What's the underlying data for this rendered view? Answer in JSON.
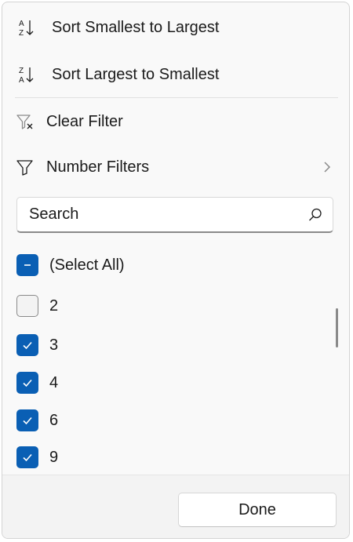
{
  "menu": {
    "sort_asc_label": "Sort Smallest to Largest",
    "sort_desc_label": "Sort Largest to Smallest",
    "clear_filter_label": "Clear Filter",
    "number_filters_label": "Number Filters"
  },
  "search": {
    "placeholder": "Search",
    "value": ""
  },
  "values_list": [
    {
      "label": "(Select All)",
      "state": "mixed"
    },
    {
      "label": "2",
      "state": "unchecked"
    },
    {
      "label": "3",
      "state": "checked"
    },
    {
      "label": "4",
      "state": "checked"
    },
    {
      "label": "6",
      "state": "checked"
    },
    {
      "label": "9",
      "state": "checked"
    }
  ],
  "footer": {
    "done_label": "Done"
  },
  "colors": {
    "accent": "#0a5fb4",
    "panel_bg": "#f9f9f9",
    "text": "#1a1a1a"
  },
  "icons": {
    "sort_asc": "sort-ascending-icon",
    "sort_desc": "sort-descending-icon",
    "clear_filter": "clear-filter-icon",
    "number_filters": "filter-icon",
    "submenu": "chevron-right-icon",
    "search": "search-icon"
  }
}
